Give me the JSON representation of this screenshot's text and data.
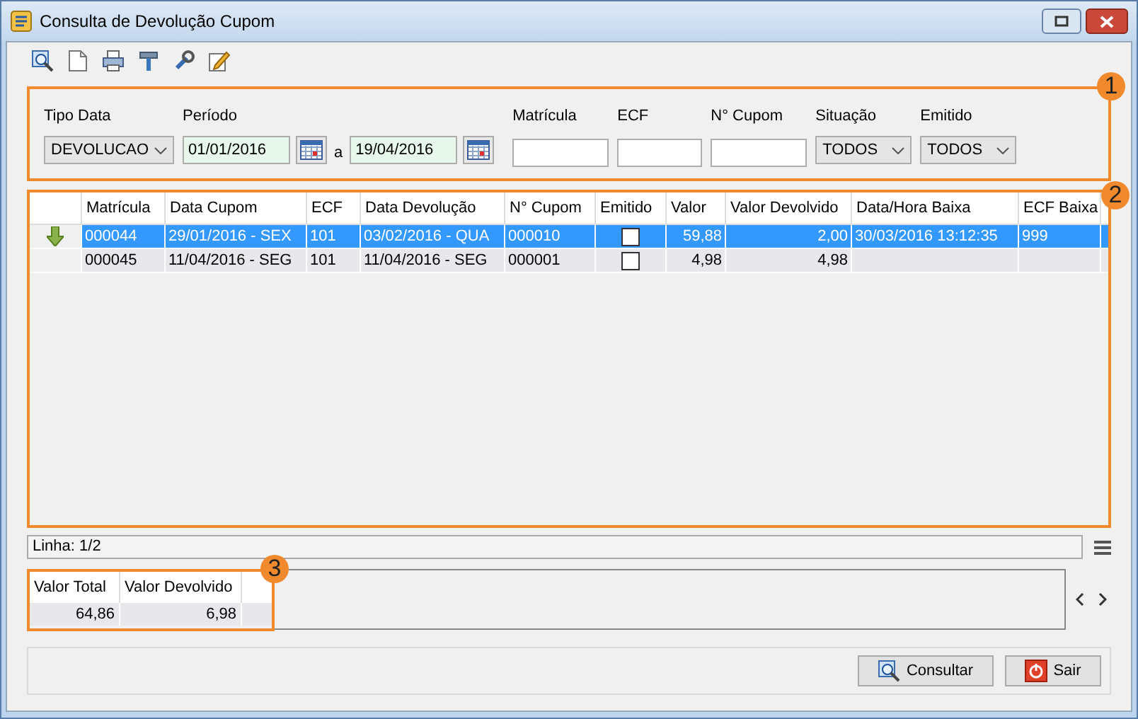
{
  "window": {
    "title": "Consulta de Devolução Cupom"
  },
  "filters": [
    {
      "label": "Tipo Data",
      "kind": "select",
      "value": "DEVOLUCAO"
    },
    {
      "label": "Período",
      "kind": "date_range",
      "from": "01/01/2016",
      "separator": "a",
      "to": "19/04/2016"
    },
    {
      "label": "Matrícula",
      "kind": "text"
    },
    {
      "label": "ECF",
      "kind": "text"
    },
    {
      "label": "N° Cupom",
      "kind": "text"
    },
    {
      "label": "Situação",
      "kind": "select",
      "value": "TODOS"
    },
    {
      "label": "Emitido",
      "kind": "select",
      "value": "TODOS"
    }
  ],
  "badges": [
    "1",
    "2",
    "3"
  ],
  "grid": {
    "columns": [
      {
        "label": "Matrícula",
        "kind": "text"
      },
      {
        "label": "Data Cupom",
        "kind": "text"
      },
      {
        "label": "ECF",
        "kind": "text"
      },
      {
        "label": "Data Devolução",
        "kind": "text"
      },
      {
        "label": "N° Cupom",
        "kind": "text"
      },
      {
        "label": "Emitido",
        "kind": "check"
      },
      {
        "label": "Valor",
        "kind": "number"
      },
      {
        "label": "Valor Devolvido",
        "kind": "number"
      },
      {
        "label": "Data/Hora Baixa",
        "kind": "text"
      },
      {
        "label": "ECF Baixa",
        "kind": "text"
      }
    ],
    "rows": [
      {
        "selected": true,
        "current": true,
        "checked": false,
        "cells": [
          "000044",
          "29/01/2016 - SEX",
          "101",
          "03/02/2016 - QUA",
          "000010",
          null,
          "59,88",
          "2,00",
          "30/03/2016 13:12:35",
          "999"
        ]
      },
      {
        "selected": false,
        "current": false,
        "checked": false,
        "cells": [
          "000045",
          "11/04/2016 - SEG",
          "101",
          "11/04/2016 - SEG",
          "000001",
          null,
          "4,98",
          "4,98",
          null,
          null
        ]
      }
    ]
  },
  "status": "Linha: 1/2",
  "totals": {
    "columns": [
      "Valor Total",
      "Valor Devolvido"
    ],
    "values": [
      "64,86",
      "6,98"
    ]
  },
  "buttons": [
    {
      "label": "Consultar",
      "kind": "search"
    },
    {
      "label": "Sair",
      "kind": "exit"
    }
  ]
}
